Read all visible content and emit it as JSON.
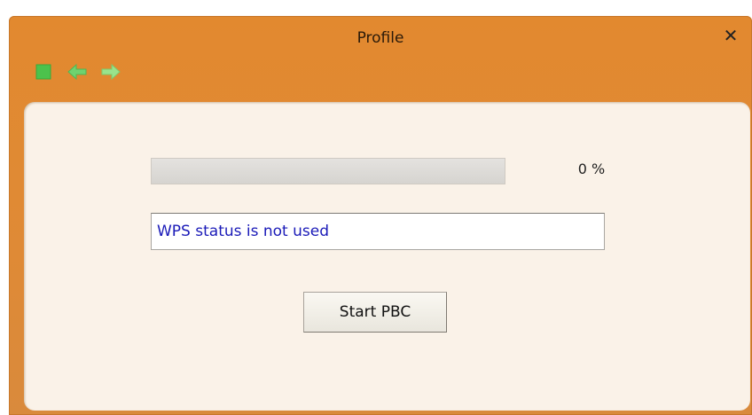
{
  "window": {
    "title": "Profile",
    "close_glyph": "✕"
  },
  "toolbar": {
    "items": [
      {
        "name": "stop-icon",
        "color": "#4cc24c"
      },
      {
        "name": "back-arrow-icon",
        "color": "#6fd36f"
      },
      {
        "name": "forward-arrow-icon",
        "color": "#9ae38c"
      }
    ]
  },
  "wps": {
    "progress_percent": 0,
    "progress_text": "0 %",
    "status_text": "WPS status is not used",
    "start_button_label": "Start PBC"
  },
  "colors": {
    "title_bar": "#df8a36",
    "panel_bg": "#faf2e8",
    "status_text": "#1a1ab8"
  }
}
